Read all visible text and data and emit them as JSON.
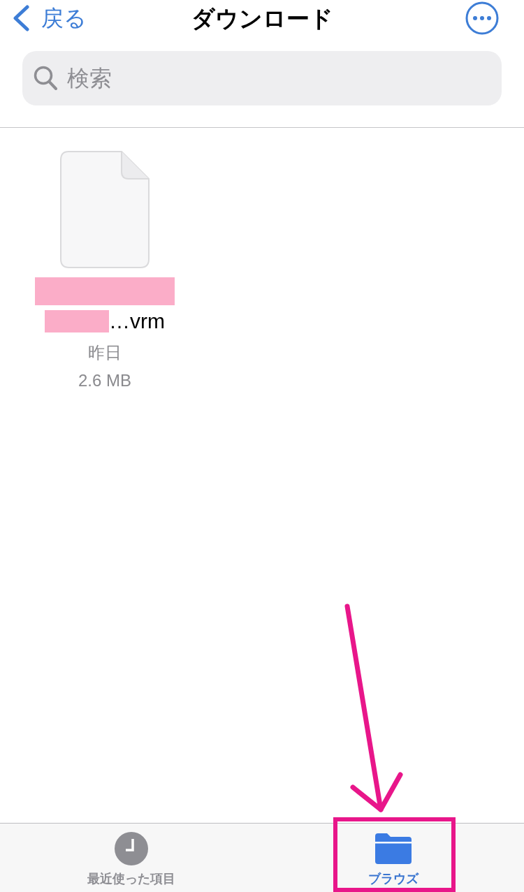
{
  "nav": {
    "back_label": "戻る",
    "title": "ダウンロード"
  },
  "search": {
    "placeholder": "検索"
  },
  "files": [
    {
      "name": "…vrm",
      "name_redacted": true,
      "date": "昨日",
      "size": "2.6 MB"
    }
  ],
  "tab_bar": {
    "tabs": [
      {
        "kind": "recents",
        "label": "最近使った項目",
        "selected": false,
        "highlighted": false
      },
      {
        "kind": "browse",
        "label": "ブラウズ",
        "selected": true,
        "highlighted": true
      }
    ]
  },
  "annotations": [
    {
      "kind": "arrow"
    }
  ]
}
